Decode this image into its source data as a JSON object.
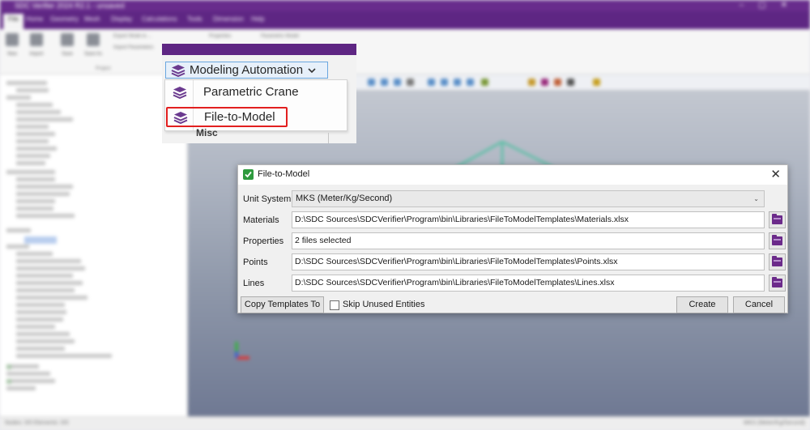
{
  "app": {
    "title": "SDC Verifier 2024 R2.1 - unsaved",
    "menu": [
      "File",
      "Home",
      "Geometry",
      "Mesh",
      "Display",
      "Calculations",
      "Tools",
      "Dimension",
      "Help"
    ]
  },
  "ribbon": {
    "buttons": [
      "New",
      "Import",
      "Save",
      "Save As"
    ],
    "group_label": "Project",
    "options": [
      "Export Mode to ...",
      "Import Parameters",
      "Properties",
      "Parametric Model"
    ]
  },
  "statusbar": {
    "left": "Nodes: 0/0  Elements: 0/0",
    "right": "MKS (Meter/Kg/Second)"
  },
  "modeling_automation": {
    "button_label": "Modeling Automation",
    "items": [
      {
        "label": "Parametric Crane",
        "icon": "layers-icon"
      },
      {
        "label": "File-to-Model",
        "icon": "layers-icon",
        "highlighted": true
      }
    ],
    "section_label": "Misc"
  },
  "dialog": {
    "title": "File-to-Model",
    "unit_system": {
      "label": "Unit System",
      "value": "MKS (Meter/Kg/Second)"
    },
    "rows": [
      {
        "label": "Materials",
        "value": "D:\\SDC Sources\\SDCVerifier\\Program\\bin\\Libraries\\FileToModelTemplates\\Materials.xlsx"
      },
      {
        "label": "Properties",
        "value": "2 files selected"
      },
      {
        "label": "Points",
        "value": "D:\\SDC Sources\\SDCVerifier\\Program\\bin\\Libraries\\FileToModelTemplates\\Points.xlsx"
      },
      {
        "label": "Lines",
        "value": "D:\\SDC Sources\\SDCVerifier\\Program\\bin\\Libraries\\FileToModelTemplates\\Lines.xlsx"
      }
    ],
    "copy_templates_label": "Copy Templates To",
    "skip_unused_label": "Skip Unused Entities",
    "create_label": "Create",
    "cancel_label": "Cancel",
    "close_glyph": "✕"
  },
  "colors": {
    "brand_purple": "#5e2683",
    "highlight_red": "#e21f1f",
    "check_green": "#2e9a3e"
  }
}
